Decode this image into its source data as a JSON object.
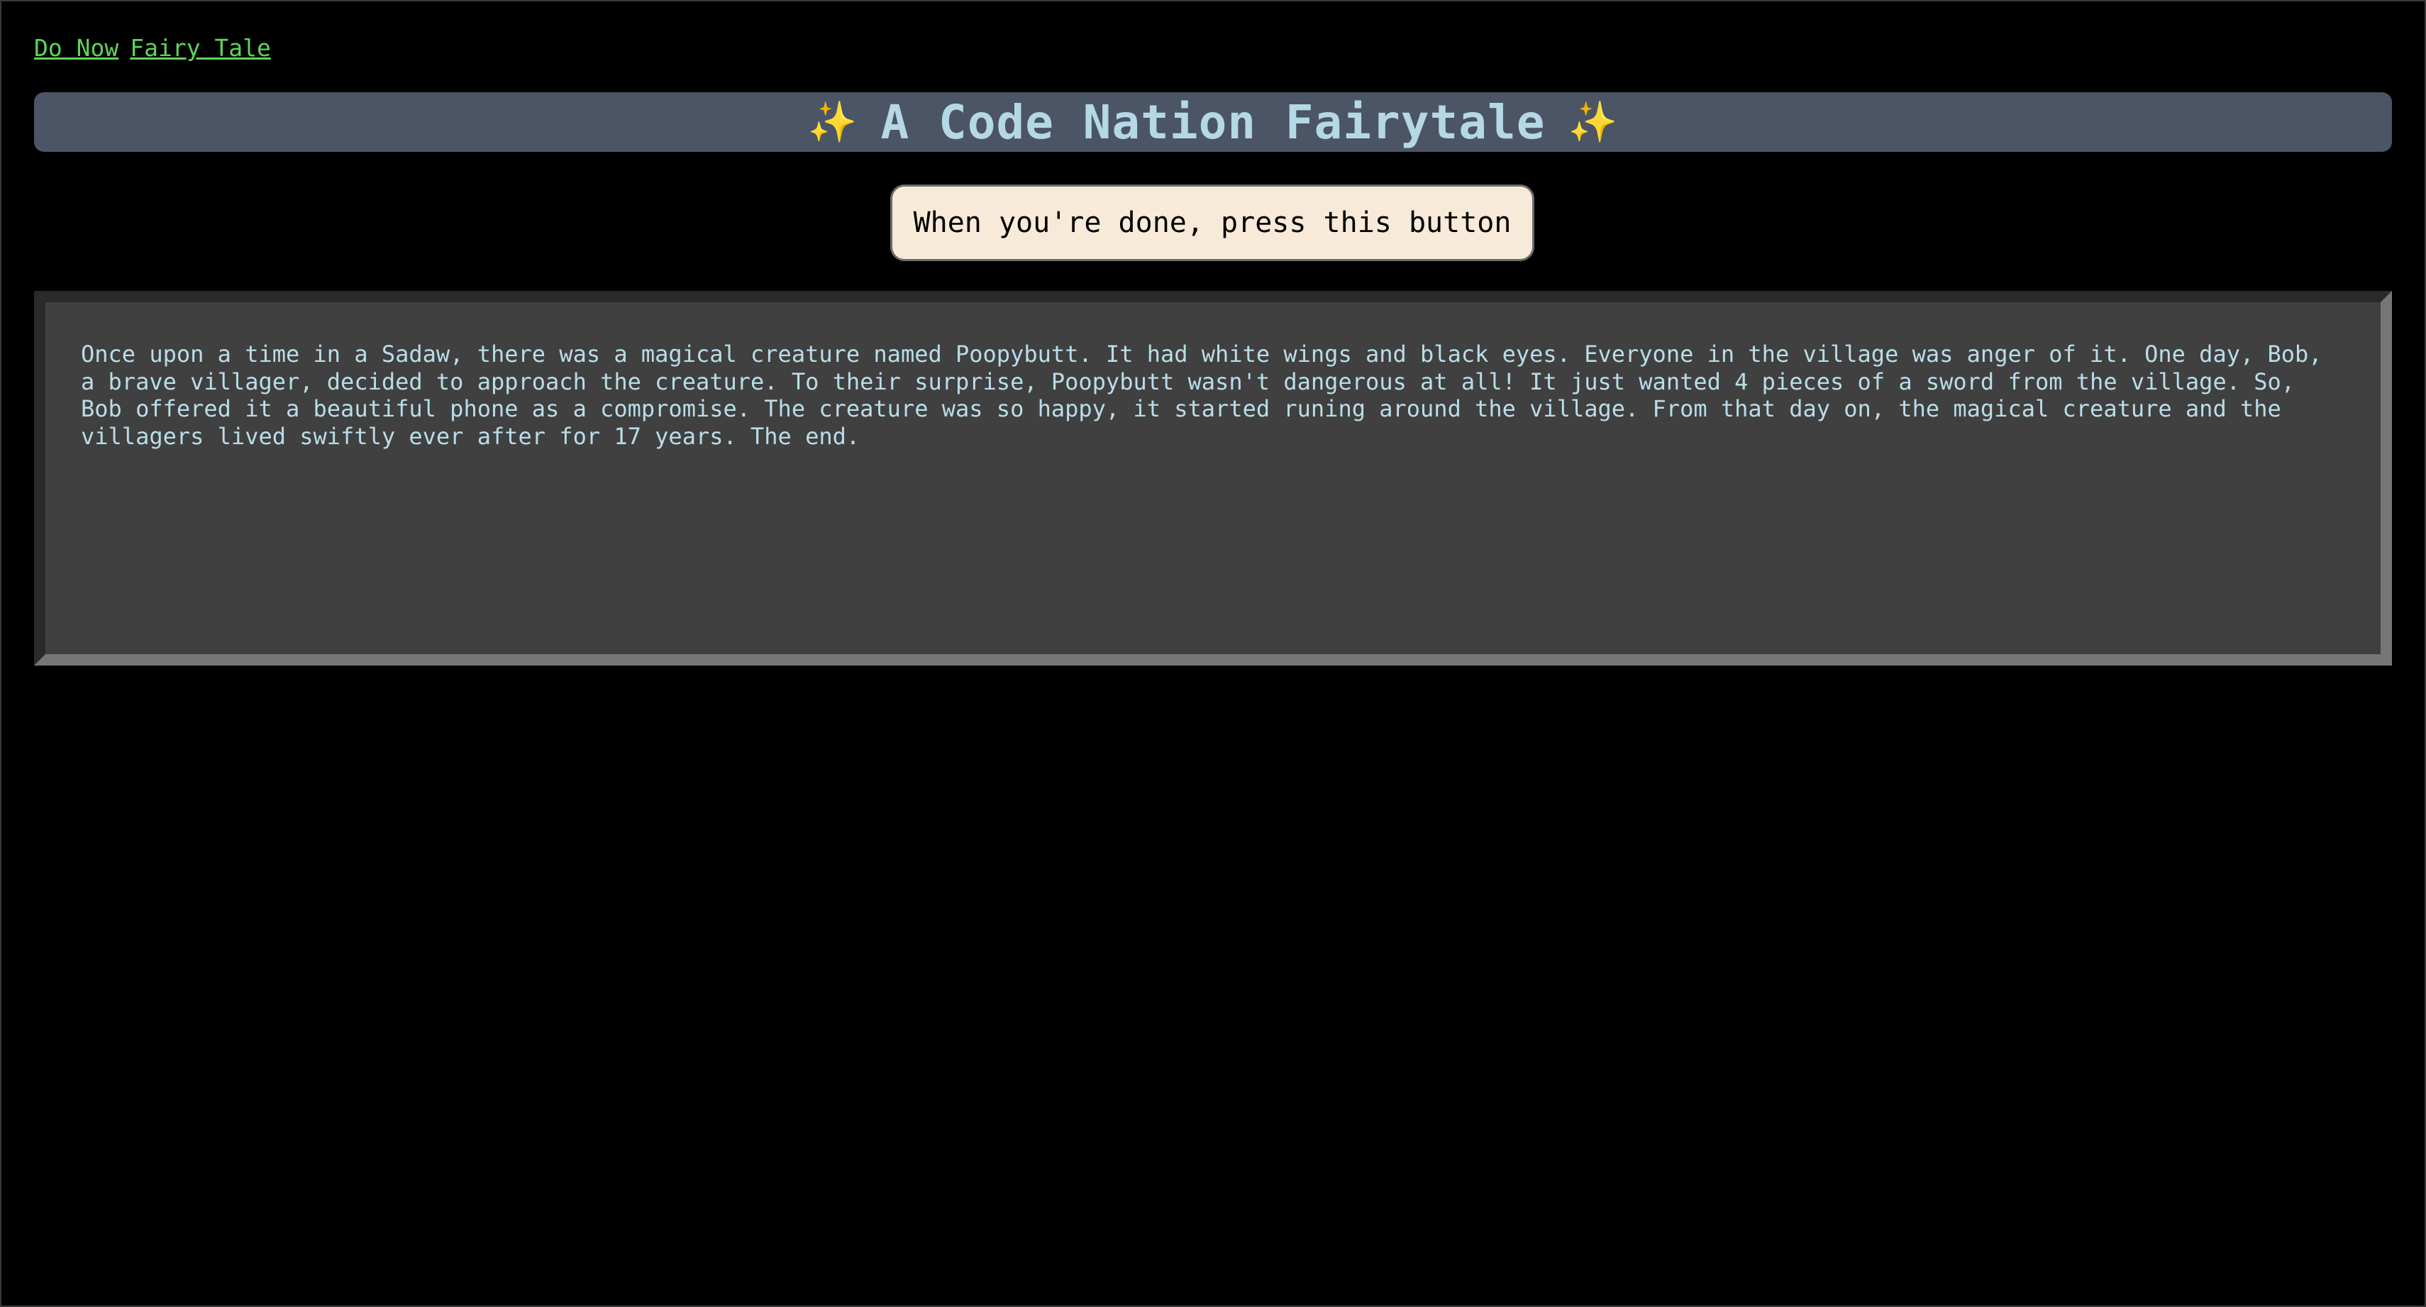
{
  "nav": {
    "links": [
      {
        "label": "Do Now"
      },
      {
        "label": "Fairy Tale"
      }
    ]
  },
  "header": {
    "sparkle_left": "✨",
    "title": "A Code Nation Fairytale",
    "sparkle_right": "✨",
    "sparkle_icon": "sparkles-icon"
  },
  "done_button": {
    "label": "When you're done, press this button"
  },
  "story": {
    "text": "Once upon a time in a Sadaw, there was a magical creature named Poopybutt. It had white wings and black eyes. Everyone in the village was anger of it. One day, Bob, a brave villager, decided to approach the creature. To their surprise, Poopybutt wasn't dangerous at all! It just wanted 4 pieces of a sword from the village. So, Bob offered it a beautiful phone as a compromise. The creature was so happy, it started runing around the village. From that day on, the magical creature and the villagers lived swiftly ever after for 17 years. The end."
  },
  "colors": {
    "background": "#000000",
    "link": "#5fd35a",
    "title_bar": "#4b5566",
    "title_text": "#b5d8e6",
    "button_bg": "#f7ead8",
    "story_bg": "#404040",
    "story_text": "#b9dde9"
  }
}
